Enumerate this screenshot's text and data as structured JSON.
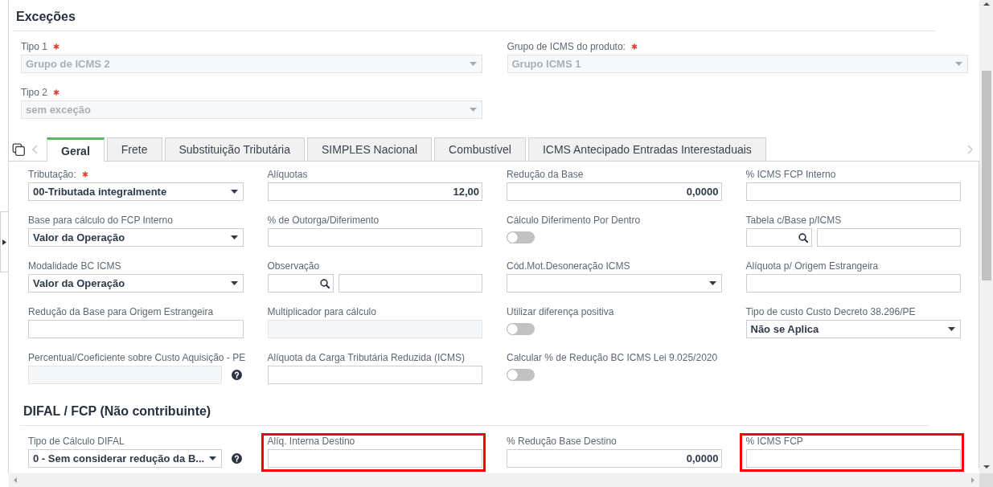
{
  "section_title": "Exceções",
  "exception_fields": [
    {
      "kind": "select",
      "label": "Tipo 1",
      "required": true,
      "disabled": true,
      "help": false,
      "value": "Grupo de ICMS 2"
    },
    {
      "kind": "select",
      "label": "Grupo de ICMS do produto:",
      "required": true,
      "disabled": true,
      "help": false,
      "value": "Grupo ICMS 1"
    },
    {
      "kind": "select",
      "label": "Tipo 2",
      "required": true,
      "disabled": true,
      "help": false,
      "value": "sem exceção"
    }
  ],
  "tabs": [
    {
      "label": "Geral",
      "selected": true
    },
    {
      "label": "Frete",
      "selected": false
    },
    {
      "label": "Substituição Tributária",
      "selected": false
    },
    {
      "label": "SIMPLES Nacional",
      "selected": false
    },
    {
      "label": "Combustível",
      "selected": false
    },
    {
      "label": "ICMS Antecipado Entradas Interestaduais",
      "selected": false
    }
  ],
  "fields": [
    {
      "kind": "select",
      "label": "Tributação:",
      "required": true,
      "disabled": false,
      "help": false,
      "value": "00-Tributada integralmente"
    },
    {
      "kind": "number",
      "label": "Alíquotas",
      "required": false,
      "disabled": false,
      "help": false,
      "value": "12,00"
    },
    {
      "kind": "number",
      "label": "Redução da Base",
      "required": false,
      "disabled": false,
      "help": false,
      "value": "0,0000"
    },
    {
      "kind": "text",
      "label": "% ICMS FCP Interno",
      "required": false,
      "disabled": false,
      "help": false
    },
    {
      "kind": "select",
      "label": "Base para cálculo do FCP Interno",
      "required": false,
      "disabled": false,
      "help": false,
      "value": "Valor da Operação"
    },
    {
      "kind": "text",
      "label": "% de Outorga/Diferimento",
      "required": false,
      "disabled": false,
      "help": false
    },
    {
      "kind": "toggle",
      "label": "Cálculo Diferimento Por Dentro",
      "required": false,
      "disabled": false,
      "help": false,
      "on": false
    },
    {
      "kind": "lookup",
      "label": "Tabela c/Base p/ICMS",
      "required": false,
      "disabled": false,
      "help": false
    },
    {
      "kind": "select",
      "label": "Modalidade BC ICMS",
      "required": false,
      "disabled": false,
      "help": false,
      "value": "Valor da Operação"
    },
    {
      "kind": "lookup",
      "label": "Observação",
      "required": false,
      "disabled": false,
      "help": false
    },
    {
      "kind": "select",
      "label": "Cód.Mot.Desoneração ICMS",
      "required": false,
      "disabled": false,
      "help": false
    },
    {
      "kind": "text",
      "label": "Alíquota p/ Origem Estrangeira",
      "required": false,
      "disabled": false,
      "help": false
    },
    {
      "kind": "text",
      "label": "Redução da Base para Origem Estrangeira",
      "required": false,
      "disabled": false,
      "help": false
    },
    {
      "kind": "text",
      "label": "Multiplicador para cálculo",
      "required": false,
      "disabled": true,
      "help": false
    },
    {
      "kind": "toggle",
      "label": "Utilizar diferença positiva",
      "required": false,
      "disabled": false,
      "help": false,
      "on": false
    },
    {
      "kind": "select",
      "label": "Tipo de custo Custo Decreto 38.296/PE",
      "required": false,
      "disabled": false,
      "help": false,
      "value": "Não se Aplica"
    },
    {
      "kind": "text",
      "label": "Percentual/Coeficiente sobre Custo Aquisição - PE",
      "required": false,
      "disabled": true,
      "help": true
    },
    {
      "kind": "text",
      "label": "Alíquota da Carga Tributária Reduzida (ICMS)",
      "required": false,
      "disabled": false,
      "help": false
    },
    {
      "kind": "toggle",
      "label": "Calcular % de Redução BC ICMS Lei 9.025/2020",
      "required": false,
      "disabled": false,
      "help": false,
      "on": false
    }
  ],
  "difal": {
    "title": "DIFAL / FCP (Não contribuinte)",
    "fields": [
      {
        "kind": "select",
        "label": "Tipo de Cálculo DIFAL",
        "required": false,
        "disabled": false,
        "help": true,
        "highlighted": false,
        "value": "0 - Sem considerar redução da B..."
      },
      {
        "kind": "text",
        "label": "Alíq. Interna Destino",
        "required": false,
        "disabled": false,
        "help": false,
        "highlighted": true
      },
      {
        "kind": "number",
        "label": "% Redução Base Destino",
        "required": false,
        "disabled": false,
        "help": false,
        "highlighted": false,
        "value": "0,0000"
      },
      {
        "kind": "text",
        "label": "% ICMS FCP",
        "required": false,
        "disabled": false,
        "help": false,
        "highlighted": true
      }
    ]
  }
}
